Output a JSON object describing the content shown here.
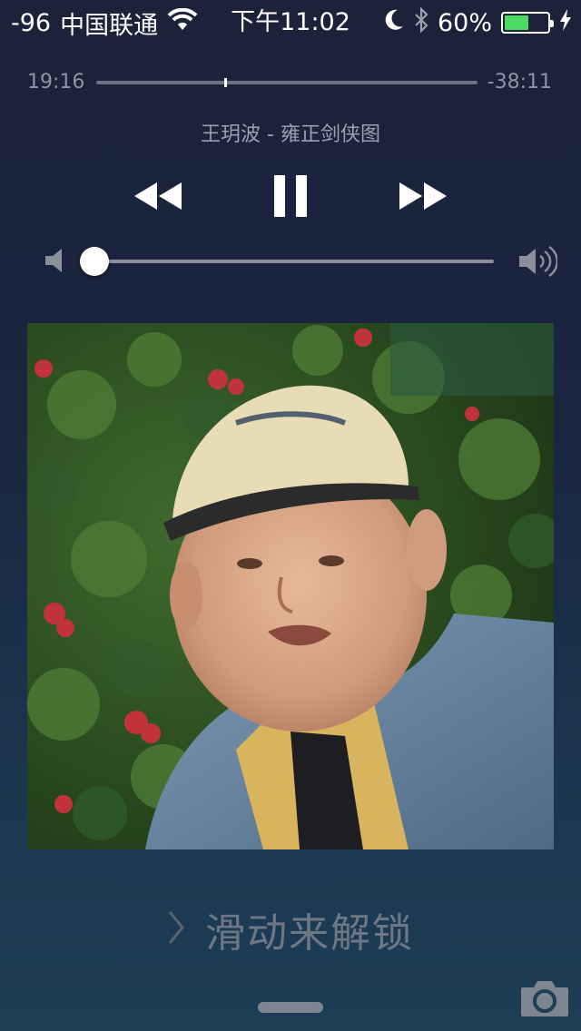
{
  "status_bar": {
    "signal": "-96",
    "carrier": "中国联通",
    "time": "下午11:02",
    "battery_percent": "60%",
    "battery_level": 0.6,
    "icons": [
      "wifi-icon",
      "moon-icon",
      "bluetooth-icon",
      "battery-icon",
      "charging-bolt-icon"
    ]
  },
  "player": {
    "elapsed": "19:16",
    "remaining": "-38:11",
    "progress": 0.336,
    "song_title": "王玥波 - 雍正剑侠图",
    "controls": {
      "rewind": "rewind-icon",
      "pause": "pause-icon",
      "forward": "fast-forward-icon"
    },
    "volume": 0.0,
    "volume_icons": [
      "speaker-low-icon",
      "speaker-high-icon"
    ]
  },
  "album_art": {
    "description_icon": "album-art-image"
  },
  "lock_screen": {
    "unlock_text": "滑动来解锁",
    "camera_icon": "camera-icon"
  },
  "colors": {
    "battery_fill": "#4cd964",
    "muted_text": "#8e94a2"
  }
}
